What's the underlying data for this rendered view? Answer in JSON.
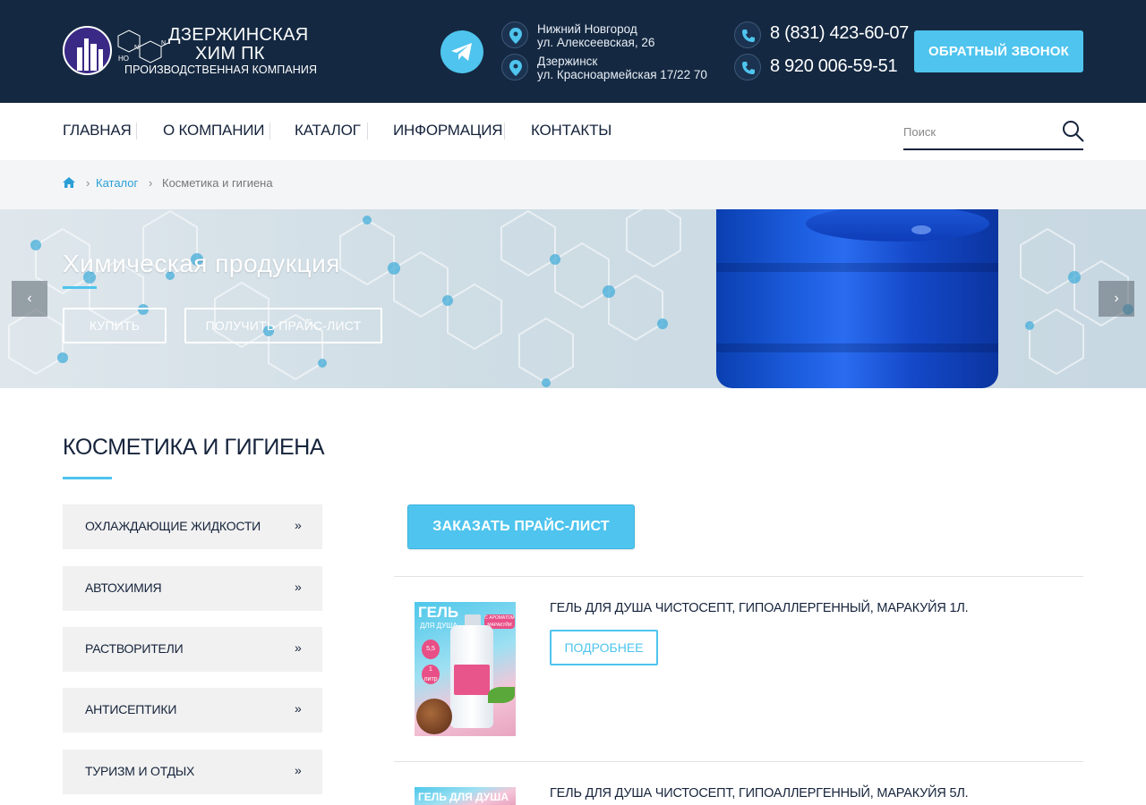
{
  "header": {
    "logo": {
      "line1": "ДЗЕРЖИНСКАЯ",
      "line2": "ХИМ ПК",
      "line3": "ПРОИЗВОДСТВЕННАЯ КОМПАНИЯ",
      "mol_label_1": "HO",
      "mol_label_2": "N",
      "mol_label_3": "N"
    },
    "addresses": [
      {
        "city": "Нижний Новгород",
        "street": "ул. Алексеевская, 26"
      },
      {
        "city": "Дзержинск",
        "street": "ул. Красноармейская 17/22 70"
      }
    ],
    "phones": [
      "8 (831) 423-60-07",
      "8 920 006-59-51"
    ],
    "callback_label": "ОБРАТНЫЙ ЗВОНОК"
  },
  "nav": {
    "items": [
      "ГЛАВНАЯ",
      "О КОМПАНИИ",
      "КАТАЛОГ",
      "ИНФОРМАЦИЯ",
      "КОНТАКТЫ"
    ],
    "search_placeholder": "Поиск"
  },
  "breadcrumb": {
    "link": "Каталог",
    "current": "Косметика и гигиена"
  },
  "banner": {
    "title": "Химическая продукция",
    "buy_label": "КУПИТЬ",
    "pricelist_label": "ПОЛУЧИТЬ ПРАЙС-ЛИСТ",
    "prev_glyph": "‹",
    "next_glyph": "›"
  },
  "section": {
    "title": "КОСМЕТИКА И ГИГИЕНА",
    "categories": [
      "ОХЛАЖДАЮЩИЕ ЖИДКОСТИ",
      "АВТОХИМИЯ",
      "РАСТВОРИТЕЛИ",
      "АНТИСЕПТИКИ",
      "ТУРИЗМ И ОТДЫХ"
    ],
    "category_arrow": "»"
  },
  "order_price_label": "ЗАКАЗАТЬ ПРАЙС-ЛИСТ",
  "products": [
    {
      "title": "ГЕЛЬ ДЛЯ ДУША ЧИСТОСЕПТ, ГИПОАЛЛЕРГЕННЫЙ, МАРАКУЙЯ 1Л.",
      "details_label": "ПОДРОБНЕЕ",
      "img_title": "ГЕЛЬ",
      "img_sub": "ДЛЯ ДУША",
      "img_ph": "5,5 pH",
      "img_volume": "1 литр",
      "img_tag": "С АРОМАТОМ МАРАКУЙИ"
    },
    {
      "title": "ГЕЛЬ ДЛЯ ДУША ЧИСТОСЕПТ, ГИПОАЛЛЕРГЕННЫЙ, МАРАКУЙЯ 5Л.",
      "img_title": "ГЕЛЬ ДЛЯ ДУША"
    }
  ],
  "colors": {
    "header_bg": "#142841",
    "accent": "#4ec4ee",
    "text_dark": "#15233b"
  }
}
